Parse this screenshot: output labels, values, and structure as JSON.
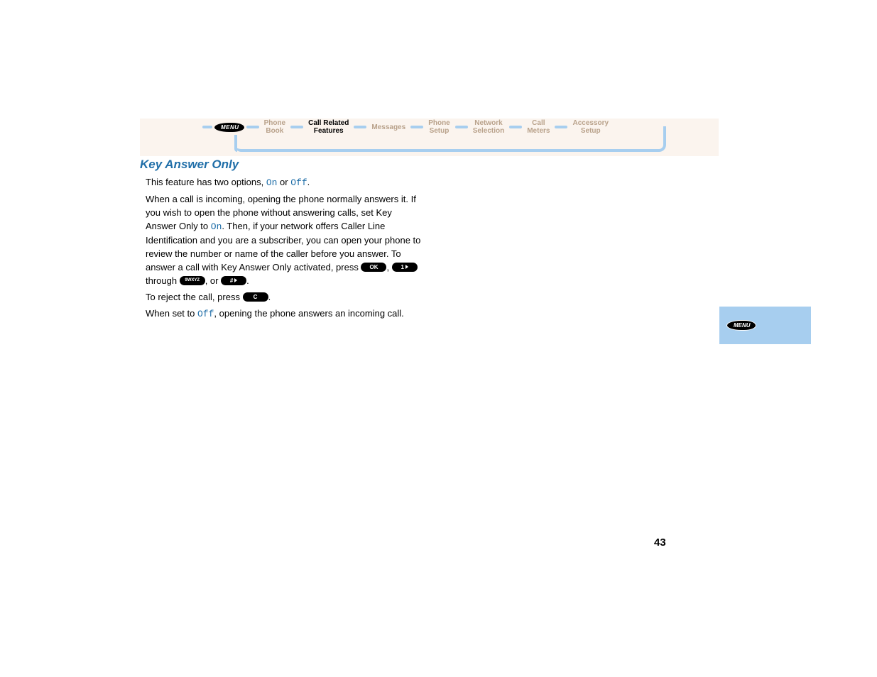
{
  "nav": {
    "menu_label": "MENU",
    "items": [
      {
        "line1": "Phone",
        "line2": "Book",
        "active": false
      },
      {
        "line1": "Call Related",
        "line2": "Features",
        "active": true
      },
      {
        "line1": "Messages",
        "line2": "",
        "active": false
      },
      {
        "line1": "Phone",
        "line2": "Setup",
        "active": false
      },
      {
        "line1": "Network",
        "line2": "Selection",
        "active": false
      },
      {
        "line1": "Call",
        "line2": "Meters",
        "active": false
      },
      {
        "line1": "Accessory",
        "line2": "Setup",
        "active": false
      }
    ]
  },
  "section_title": "Key Answer Only",
  "p1_a": "This feature has two options, ",
  "p1_on": "On",
  "p1_b": " or ",
  "p1_off": "Off",
  "p1_c": ".",
  "p2_a": "When a call is incoming, opening the phone normally answers it. If you wish to open the phone without answering calls, set Key Answer Only to ",
  "p2_on": "On",
  "p2_b": ". Then, if your network offers Caller Line Identification and you are a subscriber, you can open your phone to review the number or name of the caller before you answer. To answer a call with Key Answer Only activated, press ",
  "key_ok": "OK",
  "p2_c": ", ",
  "key_1": "1",
  "p2_d": " through ",
  "key_9": "9WXYZ",
  "p2_e": ", or ",
  "key_hash": "#",
  "p2_f": ".",
  "p3_a": "To reject the call, press ",
  "key_c": "C",
  "p3_b": ".",
  "p4_a": "When set to ",
  "p4_off": "Off",
  "p4_b": ", opening the phone answers an incoming call.",
  "side_tab_label": "MENU",
  "page_number": "43"
}
